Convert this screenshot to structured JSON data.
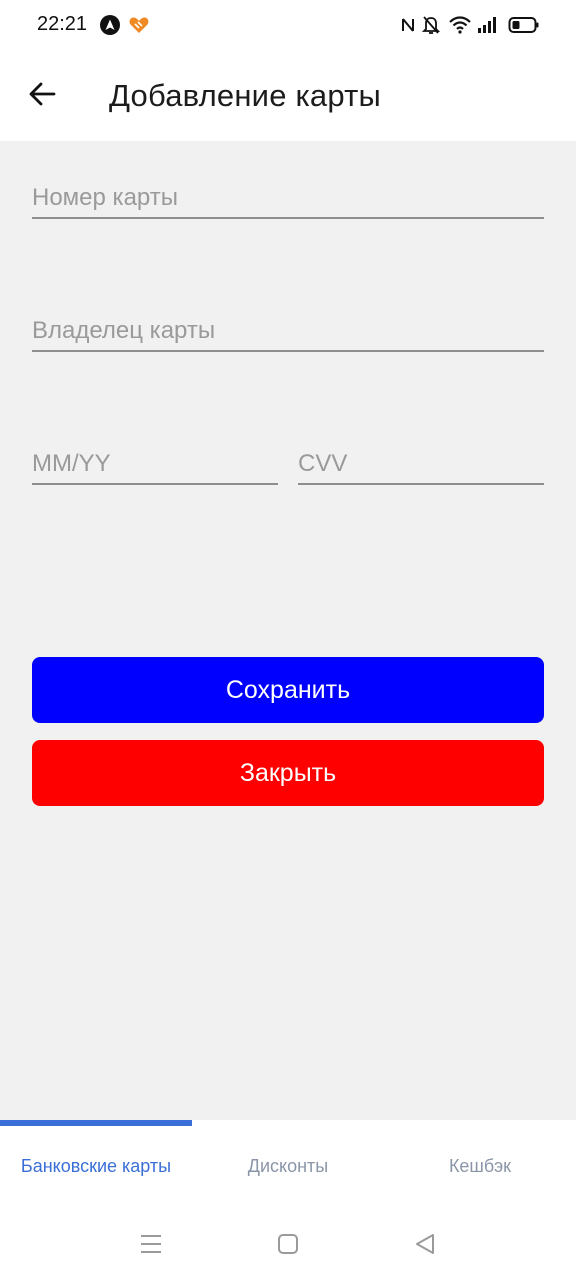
{
  "status_bar": {
    "time": "22:21",
    "left_icons": [
      "navigation-app-icon",
      "heart-app-icon"
    ],
    "right_icons": [
      "nfc-icon",
      "bell-off-icon",
      "wifi-icon",
      "signal-icon",
      "battery-icon"
    ]
  },
  "app_bar": {
    "back_icon": "arrow-left-icon",
    "title": "Добавление карты"
  },
  "form": {
    "card_number": {
      "placeholder": "Номер карты",
      "value": ""
    },
    "card_holder": {
      "placeholder": "Владелец карты",
      "value": ""
    },
    "expiry": {
      "placeholder": "MM/YY",
      "value": ""
    },
    "cvv": {
      "placeholder": "CVV",
      "value": ""
    }
  },
  "buttons": {
    "save_label": "Сохранить",
    "close_label": "Закрыть"
  },
  "tabs": [
    {
      "label": "Банковские карты",
      "active": true
    },
    {
      "label": "Дисконты",
      "active": false
    },
    {
      "label": "Кешбэк",
      "active": false
    }
  ],
  "nav_bar": {
    "icons": [
      "menu-icon",
      "home-icon",
      "back-icon"
    ]
  },
  "colors": {
    "save_button": "#0000ff",
    "close_button": "#ff0000",
    "tab_active": "#3a6fd8",
    "background": "#f1f1f1"
  }
}
